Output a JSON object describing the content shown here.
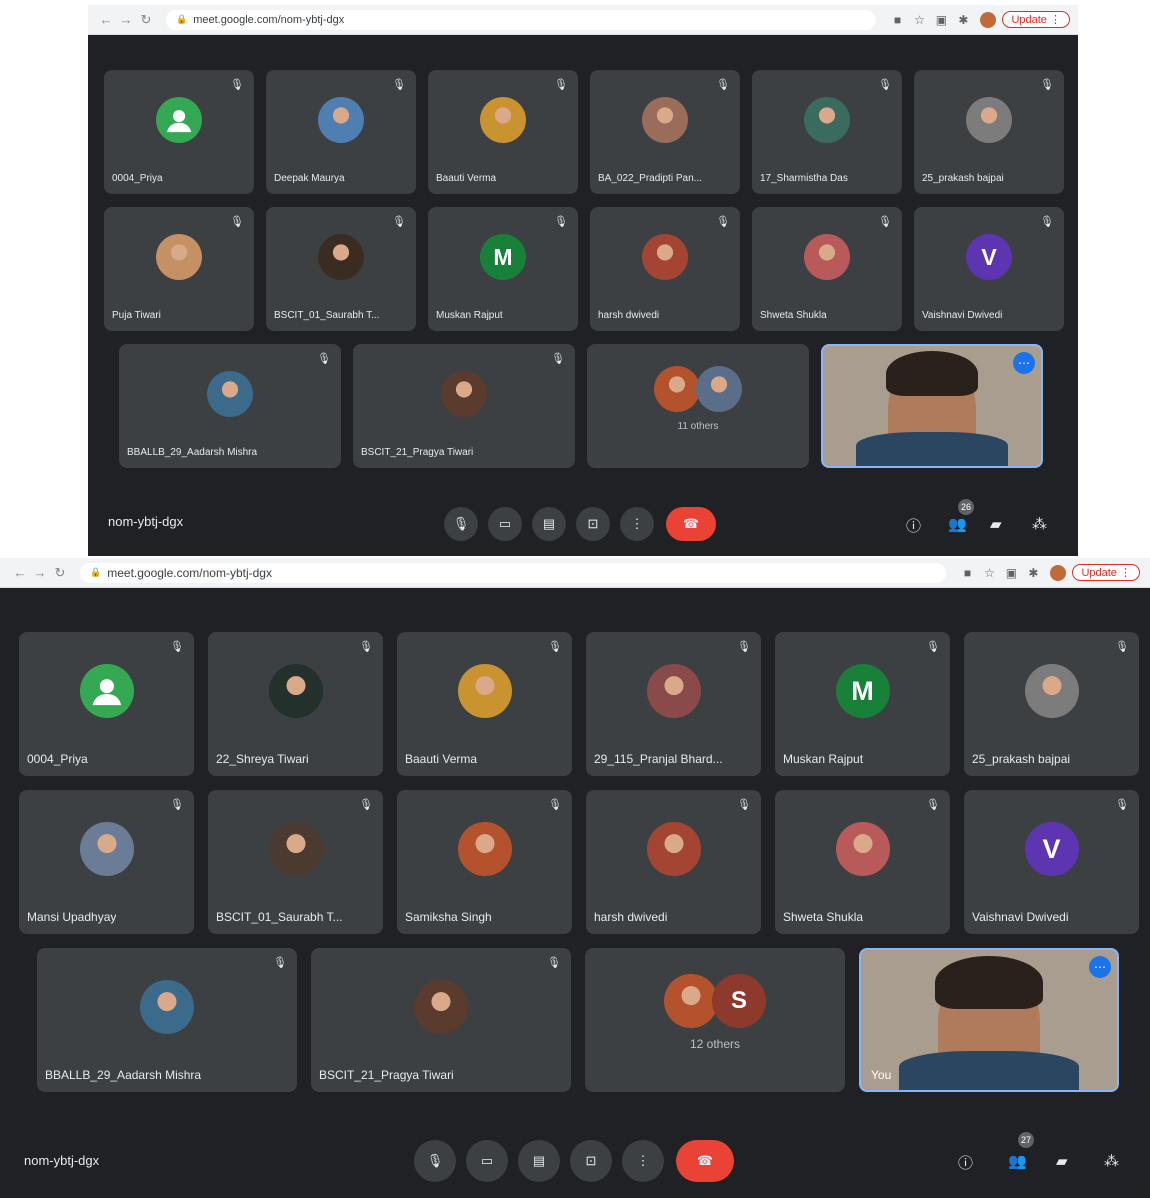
{
  "screenshot1": {
    "url": "meet.google.com/nom-ybtj-dgx",
    "update_label": "Update",
    "meeting_code": "nom-ybtj-dgx",
    "participants_count": "26",
    "participants": [
      {
        "name": "0004_Priya",
        "avatar": "person-icon",
        "color": "#34a853",
        "letter": ""
      },
      {
        "name": "Deepak Maurya",
        "avatar": "photo",
        "color": "#4f7fb0",
        "letter": ""
      },
      {
        "name": "Baauti Verma",
        "avatar": "photo",
        "color": "#c9932f",
        "letter": ""
      },
      {
        "name": "BA_022_Pradipti Pan...",
        "avatar": "photo",
        "color": "#9a6c5a",
        "letter": ""
      },
      {
        "name": "17_Sharmistha Das",
        "avatar": "photo",
        "color": "#3a6b5e",
        "letter": ""
      },
      {
        "name": "25_prakash bajpai",
        "avatar": "photo",
        "color": "#7c7c7c",
        "letter": ""
      },
      {
        "name": "Puja Tiwari",
        "avatar": "photo",
        "color": "#c49064",
        "letter": ""
      },
      {
        "name": "BSCIT_01_Saurabh T...",
        "avatar": "photo",
        "color": "#3b2c22",
        "letter": ""
      },
      {
        "name": "Muskan Rajput",
        "avatar": "letter",
        "color": "#188038",
        "letter": "M"
      },
      {
        "name": "harsh dwivedi",
        "avatar": "photo",
        "color": "#a34532",
        "letter": ""
      },
      {
        "name": "Shweta Shukla",
        "avatar": "photo",
        "color": "#b85a5a",
        "letter": ""
      },
      {
        "name": "Vaishnavi Dwivedi",
        "avatar": "letter",
        "color": "#5e35b1",
        "letter": "V"
      },
      {
        "name": "BBALLB_29_Aadarsh Mishra",
        "avatar": "photo",
        "color": "#3b6a8a",
        "letter": ""
      },
      {
        "name": "BSCIT_21_Pragya Tiwari",
        "avatar": "photo",
        "color": "#5a3b2e",
        "letter": ""
      }
    ],
    "others_label": "11 others"
  },
  "screenshot2": {
    "url": "meet.google.com/nom-ybtj-dgx",
    "update_label": "Update",
    "meeting_code": "nom-ybtj-dgx",
    "participants_count": "27",
    "participants": [
      {
        "name": "0004_Priya",
        "avatar": "person-icon",
        "color": "#34a853",
        "letter": ""
      },
      {
        "name": "22_Shreya Tiwari",
        "avatar": "photo",
        "color": "#23302c",
        "letter": ""
      },
      {
        "name": "Baauti Verma",
        "avatar": "photo",
        "color": "#c9932f",
        "letter": ""
      },
      {
        "name": "29_115_Pranjal Bhard...",
        "avatar": "photo",
        "color": "#8a4a4a",
        "letter": ""
      },
      {
        "name": "Muskan Rajput",
        "avatar": "letter",
        "color": "#188038",
        "letter": "M"
      },
      {
        "name": "25_prakash bajpai",
        "avatar": "photo",
        "color": "#7c7c7c",
        "letter": ""
      },
      {
        "name": "Mansi Upadhyay",
        "avatar": "photo",
        "color": "#6a7c96",
        "letter": ""
      },
      {
        "name": "BSCIT_01_Saurabh T...",
        "avatar": "photo",
        "color": "#4a3a30",
        "letter": ""
      },
      {
        "name": "Samiksha Singh",
        "avatar": "photo",
        "color": "#b4522e",
        "letter": ""
      },
      {
        "name": "harsh dwivedi",
        "avatar": "photo",
        "color": "#a34532",
        "letter": ""
      },
      {
        "name": "Shweta Shukla",
        "avatar": "photo",
        "color": "#b85a5a",
        "letter": ""
      },
      {
        "name": "Vaishnavi Dwivedi",
        "avatar": "letter",
        "color": "#5e35b1",
        "letter": "V"
      },
      {
        "name": "BBALLB_29_Aadarsh Mishra",
        "avatar": "photo",
        "color": "#3b6a8a",
        "letter": ""
      },
      {
        "name": "BSCIT_21_Pragya Tiwari",
        "avatar": "photo",
        "color": "#5a3b2e",
        "letter": ""
      }
    ],
    "others_label": "12 others",
    "others_letter": "S",
    "self_label": "You"
  }
}
